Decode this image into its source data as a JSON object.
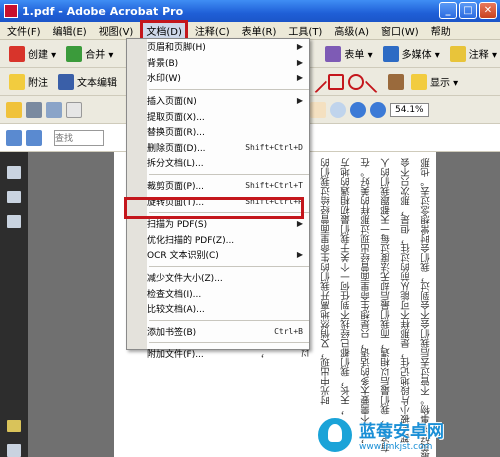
{
  "window": {
    "title": "1.pdf - Adobe Acrobat Pro",
    "min": "_",
    "max": "□",
    "close": "✕"
  },
  "menubar": [
    {
      "label": "文件(F)"
    },
    {
      "label": "编辑(E)"
    },
    {
      "label": "视图(V)"
    },
    {
      "label": "文档(D)",
      "active": true
    },
    {
      "label": "注释(C)"
    },
    {
      "label": "表单(R)"
    },
    {
      "label": "工具(T)"
    },
    {
      "label": "高级(A)"
    },
    {
      "label": "窗口(W)"
    },
    {
      "label": "帮助"
    }
  ],
  "toolbar1": {
    "create": "创建 ▾",
    "merge": "合并 ▾",
    "forms": "表单 ▾",
    "multimedia": "多媒体 ▾",
    "comment": "注释 ▾"
  },
  "toolbar2": {
    "attach": "附注",
    "text_edit": "文本编辑",
    "show": "显示 ▾"
  },
  "toolbar3": {
    "zoom": "54.1%"
  },
  "toolbar4": {
    "search_placeholder": "查找"
  },
  "document_menu": [
    {
      "label": "页眉和页脚(H)",
      "submenu": true
    },
    {
      "label": "背景(B)",
      "submenu": true
    },
    {
      "label": "水印(W)",
      "submenu": true
    },
    {
      "sep": true
    },
    {
      "label": "插入页面(N)",
      "submenu": true
    },
    {
      "label": "提取页面(X)..."
    },
    {
      "label": "替换页面(R)..."
    },
    {
      "label": "删除页面(D)...",
      "shortcut": "Shift+Ctrl+D"
    },
    {
      "label": "拆分文档(L)..."
    },
    {
      "sep": true
    },
    {
      "label": "裁剪页面(P)...",
      "shortcut": "Shift+Ctrl+T"
    },
    {
      "label": "旋转页面(T)...",
      "shortcut": "Shift+Ctrl+R",
      "highlight": true
    },
    {
      "sep": true
    },
    {
      "label": "扫描为 PDF(S)",
      "submenu": true
    },
    {
      "label": "优化扫描的 PDF(Z)..."
    },
    {
      "label": "OCR 文本识别(C)",
      "submenu": true
    },
    {
      "sep": true
    },
    {
      "label": "减少文件大小(Z)..."
    },
    {
      "label": "检查文档(I)..."
    },
    {
      "label": "比较文档(A)..."
    },
    {
      "sep": true
    },
    {
      "label": "添加书签(B)",
      "shortcut": "Ctrl+B"
    },
    {
      "sep": true
    },
    {
      "label": "附加文件(F)..."
    }
  ],
  "page_columns": [
    "最美好的事物。不管过去后我们会不会到过，我们会时常想念过去。也那",
    "都会被小片段地记住，是那样不可能从前的过往，但是，那次只不会",
    "有这样，我们最后以相遇，而我们最后却无法度过每一天都跟我们的人",
    "，并不需要太多的话语，只是想生命里面曾经出现过那样的美好。在",
    "，天长，我们都已经找不到任何一个关于我们最初相遇的地方",
    "时光中出现，又悄然地离开我们的生命里面曾经给过我们的",
    "以感谢那些逝去的美丽的时光。那美丽的我们。",
    "也是，那些与我们相遇的人",
    "，我们会带着美好的心情说。要把所有的旅途，",
    "我们看到的风景之外，都会有一些特别的东西",
    "我们在一起。，我们也许不能够经常看到的，",
    "这样的美好，在我们心中留下永远不能忘记的",
    "我们在乎的，也许是那些重要的，"
  ],
  "watermark": {
    "title": "蓝莓安卓网",
    "url": "www.lmkjst.com"
  },
  "colors": {
    "titlebar": "#1f5fd7",
    "highlight_box": "#c4161c",
    "menu_bg": "#ece9d8"
  }
}
